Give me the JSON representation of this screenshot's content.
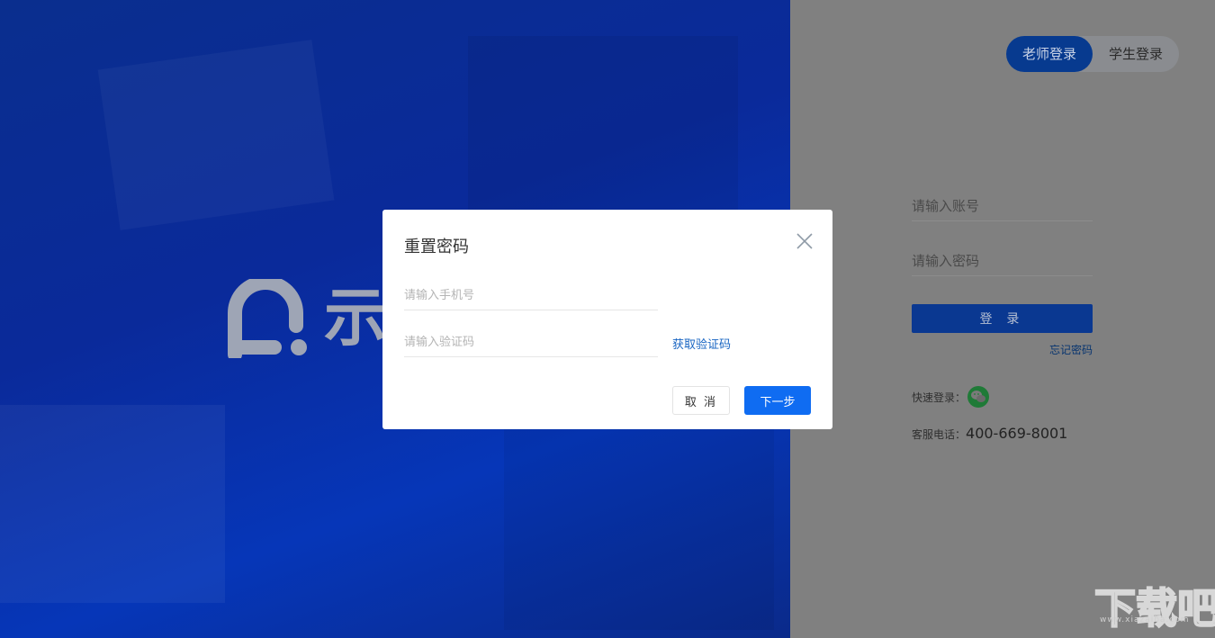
{
  "hero": {
    "logo_text": "示"
  },
  "login": {
    "role_tabs": [
      "老师登录",
      "学生登录"
    ],
    "account_placeholder": "请输入账号",
    "password_placeholder": "请输入密码",
    "login_button": "登 录",
    "forgot_password": "忘记密码",
    "quick_login_label": "快速登录：",
    "service_label": "客服电话：",
    "service_phone": "400-669-8001"
  },
  "modal": {
    "title": "重置密码",
    "phone_placeholder": "请输入手机号",
    "code_placeholder": "请输入验证码",
    "get_code": "获取验证码",
    "cancel": "取 消",
    "next": "下一步"
  },
  "watermark": {
    "text": "下载吧",
    "url": "www.xiazaiba.com"
  },
  "colors": {
    "hero_blue": "#0a2e8e",
    "primary": "#0f6cf2",
    "link": "#1764c2"
  }
}
